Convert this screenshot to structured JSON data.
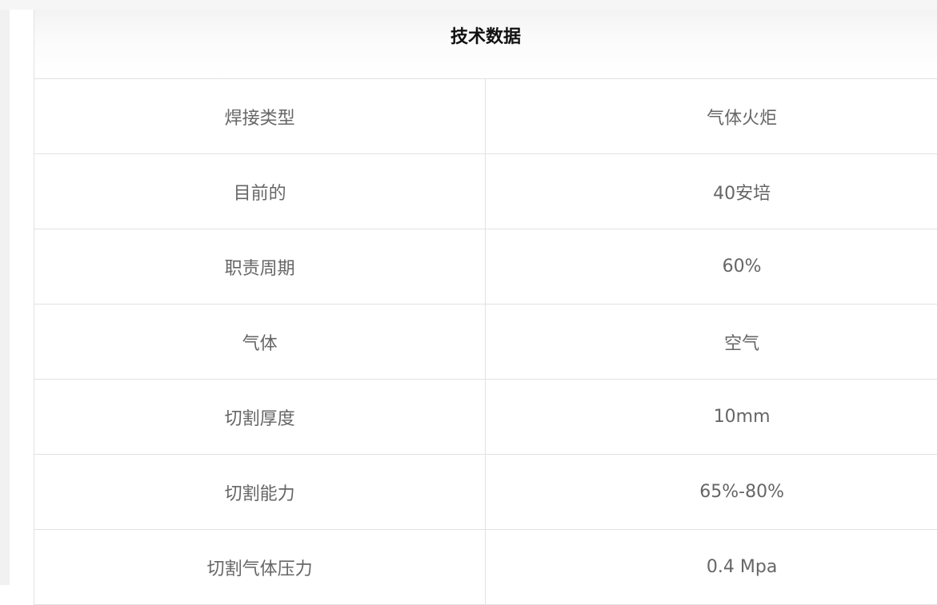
{
  "table": {
    "title": "技术数据",
    "rows": [
      {
        "label": "焊接类型",
        "value": "气体火炬"
      },
      {
        "label": "目前的",
        "value": "40安培"
      },
      {
        "label": "职责周期",
        "value": "60%"
      },
      {
        "label": "气体",
        "value": "空气"
      },
      {
        "label": "切割厚度",
        "value": "10mm"
      },
      {
        "label": "切割能力",
        "value": "65%-80%"
      },
      {
        "label": "切割气体压力",
        "value": "0.4 Mpa"
      }
    ]
  }
}
